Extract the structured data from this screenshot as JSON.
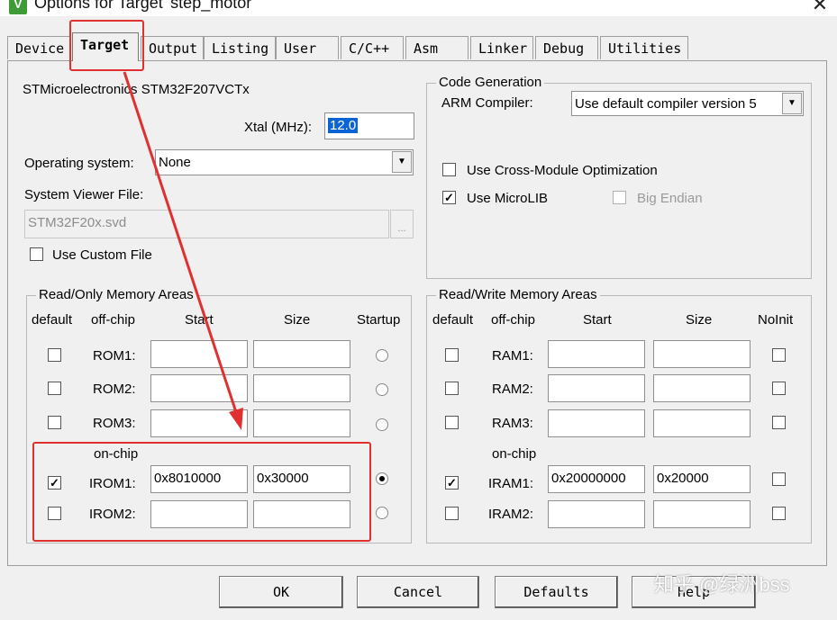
{
  "window": {
    "title": "Options for Target 'step_motor'",
    "app_icon": "V",
    "close_glyph": "✕"
  },
  "tabs": [
    {
      "label": "Device"
    },
    {
      "label": "Target"
    },
    {
      "label": "Output"
    },
    {
      "label": "Listing"
    },
    {
      "label": "User"
    },
    {
      "label": "C/C++"
    },
    {
      "label": "Asm"
    },
    {
      "label": "Linker"
    },
    {
      "label": "Debug"
    },
    {
      "label": "Utilities"
    }
  ],
  "active_tab": "Target",
  "device_name": "STMicroelectronics STM32F207VCTx",
  "xtal": {
    "label": "Xtal (MHz):",
    "value": "12.0"
  },
  "os": {
    "label": "Operating system:",
    "value": "None"
  },
  "svd": {
    "label": "System Viewer File:",
    "value": "STM32F20x.svd",
    "browse": "..."
  },
  "custom_file": {
    "label": "Use Custom File",
    "checked": false
  },
  "codegen": {
    "title": "Code Generation",
    "compiler_label": "ARM Compiler:",
    "compiler_value": "Use default compiler version 5",
    "cross_module": {
      "label": "Use Cross-Module Optimization",
      "checked": false
    },
    "microlib": {
      "label": "Use MicroLIB",
      "checked": true
    },
    "big_endian": {
      "label": "Big Endian",
      "checked": false,
      "enabled": false
    }
  },
  "rom_area": {
    "title": "Read/Only Memory Areas",
    "headers": {
      "default": "default",
      "offchip": "off-chip",
      "start": "Start",
      "size": "Size",
      "startup": "Startup"
    },
    "onchip_label": "on-chip",
    "rows": [
      {
        "label": "ROM1:",
        "default": false,
        "start": "",
        "size": "",
        "startup": false
      },
      {
        "label": "ROM2:",
        "default": false,
        "start": "",
        "size": "",
        "startup": false
      },
      {
        "label": "ROM3:",
        "default": false,
        "start": "",
        "size": "",
        "startup": false
      },
      {
        "label": "IROM1:",
        "default": true,
        "start": "0x8010000",
        "size": "0x30000",
        "startup": true
      },
      {
        "label": "IROM2:",
        "default": false,
        "start": "",
        "size": "",
        "startup": false
      }
    ]
  },
  "ram_area": {
    "title": "Read/Write Memory Areas",
    "headers": {
      "default": "default",
      "offchip": "off-chip",
      "start": "Start",
      "size": "Size",
      "noinit": "NoInit"
    },
    "onchip_label": "on-chip",
    "rows": [
      {
        "label": "RAM1:",
        "default": false,
        "start": "",
        "size": "",
        "noinit": false
      },
      {
        "label": "RAM2:",
        "default": false,
        "start": "",
        "size": "",
        "noinit": false
      },
      {
        "label": "RAM3:",
        "default": false,
        "start": "",
        "size": "",
        "noinit": false
      },
      {
        "label": "IRAM1:",
        "default": true,
        "start": "0x20000000",
        "size": "0x20000",
        "noinit": false
      },
      {
        "label": "IRAM2:",
        "default": false,
        "start": "",
        "size": "",
        "noinit": false
      }
    ]
  },
  "buttons": {
    "ok": "OK",
    "cancel": "Cancel",
    "defaults": "Defaults",
    "help": "Help"
  },
  "watermark": "知乎 @绿洲bss",
  "annotation_color": "#e03030"
}
